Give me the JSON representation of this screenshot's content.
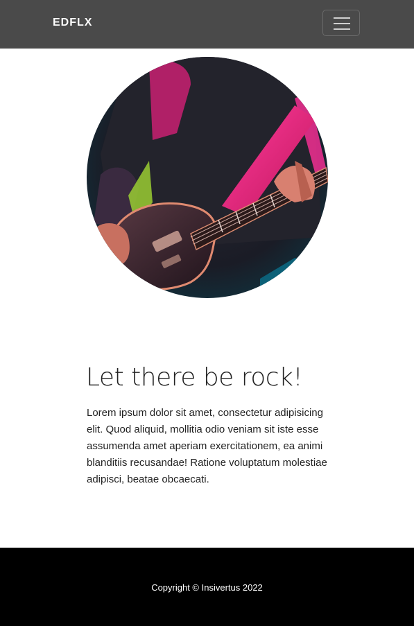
{
  "navbar": {
    "brand": "EDFLX",
    "toggle_icon": "hamburger-menu-icon"
  },
  "hero": {
    "image": "rock-guitarist-photo",
    "colors": {
      "magenta": "#e0207a",
      "teal": "#0e5a6a",
      "dark": "#1b1b24",
      "lime": "#9acd32"
    }
  },
  "main": {
    "title": "Let there be rock!",
    "paragraph": "Lorem ipsum dolor sit amet, consectetur adipisicing elit. Quod aliquid, mollitia odio veniam sit iste esse assumenda amet aperiam exercitationem, ea animi blanditiis recusandae! Ratione voluptatum molestiae adipisci, beatae obcaecati."
  },
  "footer": {
    "copyright": "Copyright © Insivertus 2022"
  }
}
